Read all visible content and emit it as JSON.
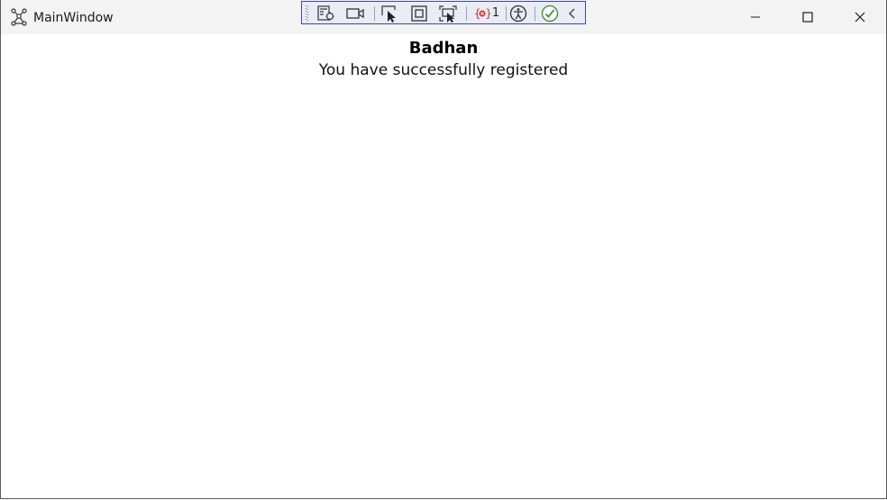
{
  "window": {
    "title": "MainWindow"
  },
  "debug_toolbar": {
    "items": [
      {
        "icon": "live-visual-tree-icon"
      },
      {
        "icon": "record-video-icon"
      },
      {
        "icon": "select-element-icon"
      },
      {
        "icon": "display-layout-adorners-icon"
      },
      {
        "icon": "track-focused-element-icon"
      },
      {
        "icon": "binding-failures-icon",
        "count": "1"
      },
      {
        "icon": "accessibility-icon"
      },
      {
        "icon": "check-ok-icon"
      },
      {
        "icon": "collapse-chevron-icon"
      }
    ],
    "binding_failures_count": "1",
    "accent_color": "#3c4aa8"
  },
  "content": {
    "name": "Badhan",
    "message": "You have successfully registered"
  }
}
